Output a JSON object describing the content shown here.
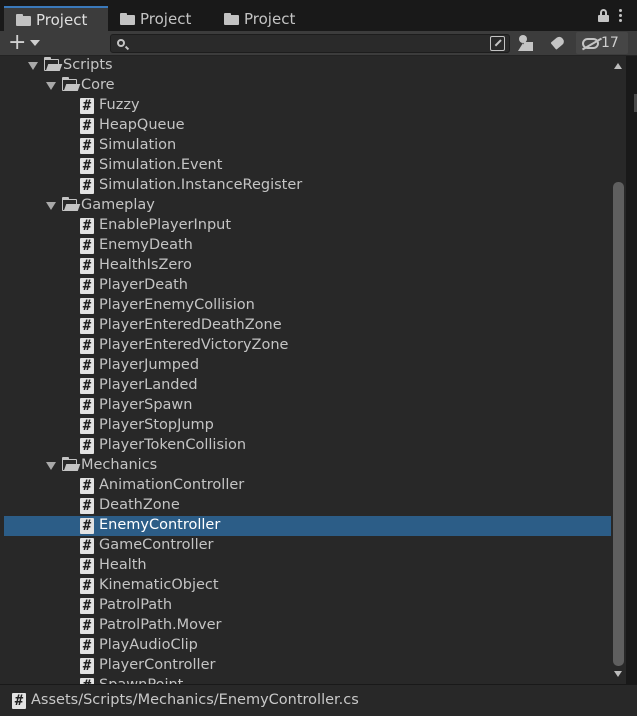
{
  "tabs": [
    {
      "label": "Project",
      "active": true
    },
    {
      "label": "Project",
      "active": false
    },
    {
      "label": "Project",
      "active": false
    }
  ],
  "toolbar": {
    "add_label": "+",
    "search_value": "",
    "hidden_count": "17"
  },
  "tree": [
    {
      "label": "Scripts",
      "type": "folder",
      "depth": 0,
      "expanded": true
    },
    {
      "label": "Core",
      "type": "folder",
      "depth": 1,
      "expanded": true
    },
    {
      "label": "Fuzzy",
      "type": "script",
      "depth": 2
    },
    {
      "label": "HeapQueue",
      "type": "script",
      "depth": 2
    },
    {
      "label": "Simulation",
      "type": "script",
      "depth": 2
    },
    {
      "label": "Simulation.Event",
      "type": "script",
      "depth": 2
    },
    {
      "label": "Simulation.InstanceRegister",
      "type": "script",
      "depth": 2
    },
    {
      "label": "Gameplay",
      "type": "folder",
      "depth": 1,
      "expanded": true
    },
    {
      "label": "EnablePlayerInput",
      "type": "script",
      "depth": 2
    },
    {
      "label": "EnemyDeath",
      "type": "script",
      "depth": 2
    },
    {
      "label": "HealthIsZero",
      "type": "script",
      "depth": 2
    },
    {
      "label": "PlayerDeath",
      "type": "script",
      "depth": 2
    },
    {
      "label": "PlayerEnemyCollision",
      "type": "script",
      "depth": 2
    },
    {
      "label": "PlayerEnteredDeathZone",
      "type": "script",
      "depth": 2
    },
    {
      "label": "PlayerEnteredVictoryZone",
      "type": "script",
      "depth": 2
    },
    {
      "label": "PlayerJumped",
      "type": "script",
      "depth": 2
    },
    {
      "label": "PlayerLanded",
      "type": "script",
      "depth": 2
    },
    {
      "label": "PlayerSpawn",
      "type": "script",
      "depth": 2
    },
    {
      "label": "PlayerStopJump",
      "type": "script",
      "depth": 2
    },
    {
      "label": "PlayerTokenCollision",
      "type": "script",
      "depth": 2
    },
    {
      "label": "Mechanics",
      "type": "folder",
      "depth": 1,
      "expanded": true
    },
    {
      "label": "AnimationController",
      "type": "script",
      "depth": 2
    },
    {
      "label": "DeathZone",
      "type": "script",
      "depth": 2
    },
    {
      "label": "EnemyController",
      "type": "script",
      "depth": 2,
      "selected": true
    },
    {
      "label": "GameController",
      "type": "script",
      "depth": 2
    },
    {
      "label": "Health",
      "type": "script",
      "depth": 2
    },
    {
      "label": "KinematicObject",
      "type": "script",
      "depth": 2
    },
    {
      "label": "PatrolPath",
      "type": "script",
      "depth": 2
    },
    {
      "label": "PatrolPath.Mover",
      "type": "script",
      "depth": 2
    },
    {
      "label": "PlayAudioClip",
      "type": "script",
      "depth": 2
    },
    {
      "label": "PlayerController",
      "type": "script",
      "depth": 2
    },
    {
      "label": "SpawnPoint",
      "type": "script",
      "depth": 2
    }
  ],
  "status": {
    "path": "Assets/Scripts/Mechanics/EnemyController.cs"
  },
  "colors": {
    "selection": "#2c5d87",
    "tab_accent": "#3a79bb",
    "panel_bg": "#282828"
  }
}
